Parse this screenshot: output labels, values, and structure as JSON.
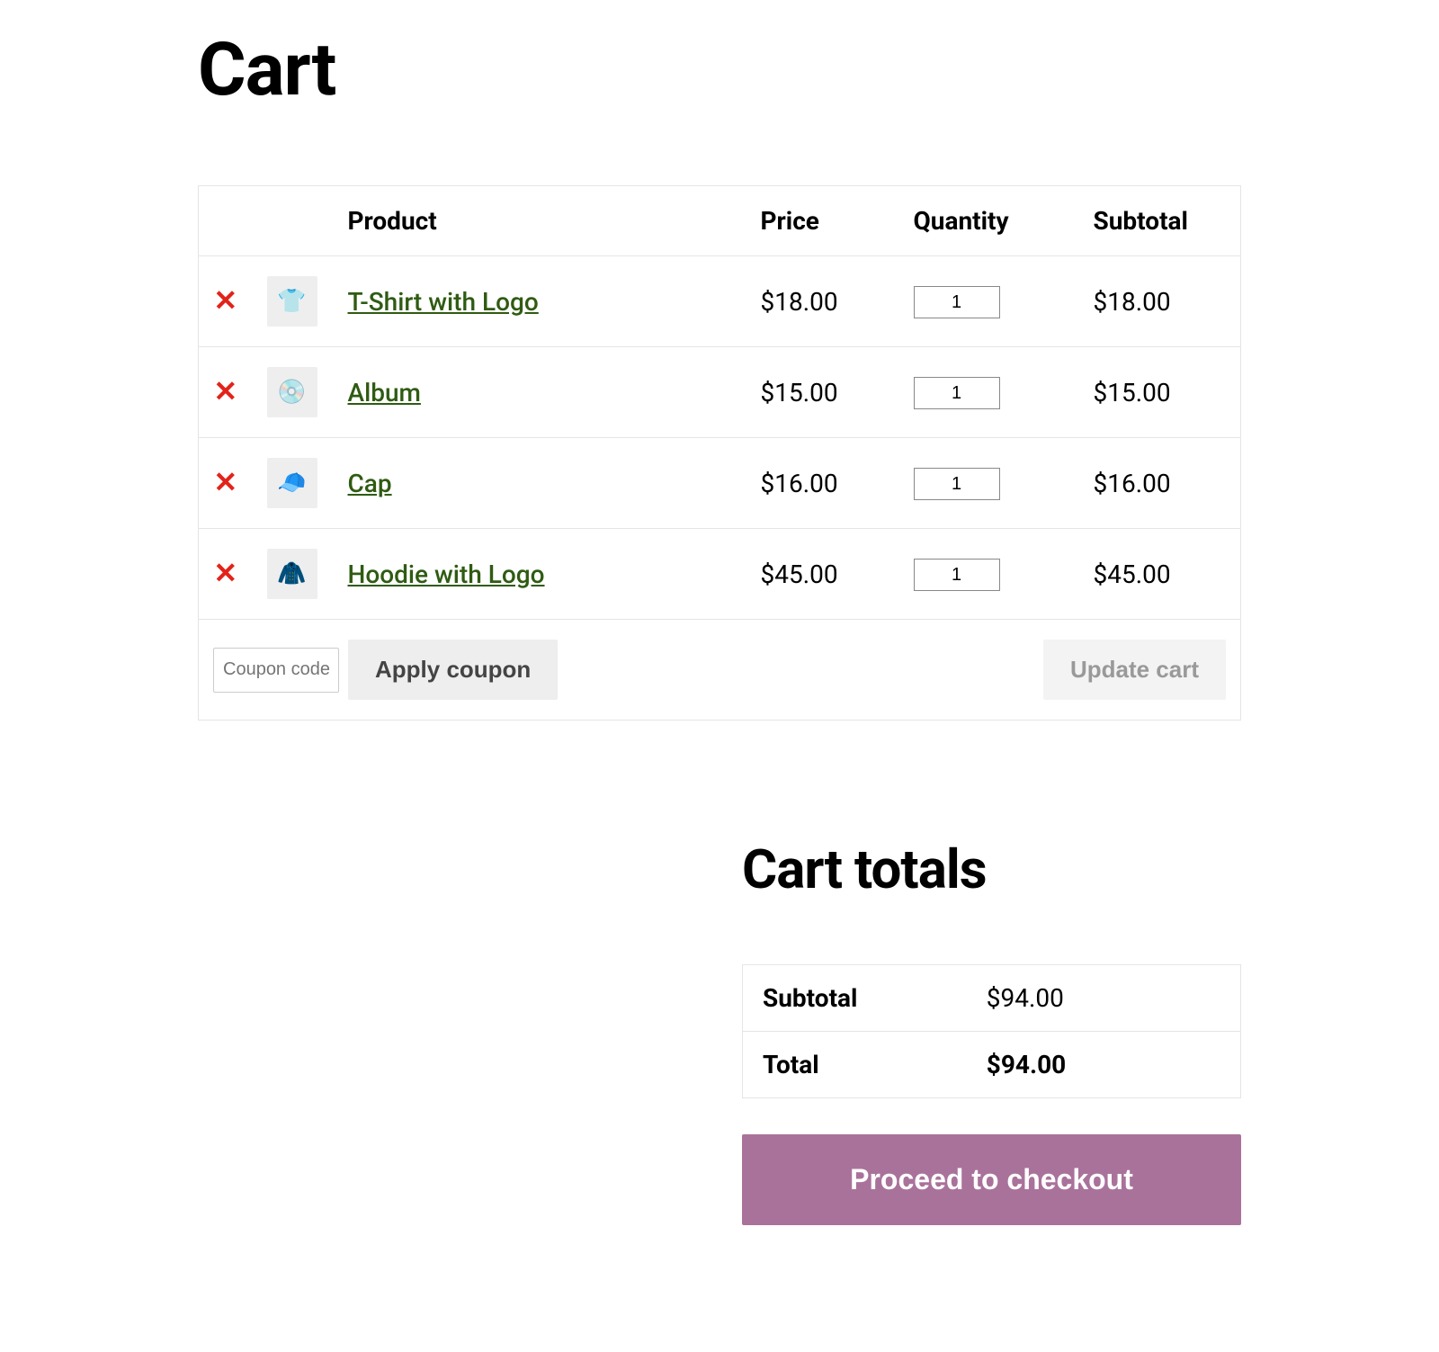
{
  "page": {
    "title": "Cart"
  },
  "table": {
    "headers": {
      "product": "Product",
      "price": "Price",
      "quantity": "Quantity",
      "subtotal": "Subtotal"
    },
    "items": [
      {
        "name": "T-Shirt with Logo",
        "price": "$18.00",
        "qty": "1",
        "subtotal": "$18.00",
        "thumb_glyph": "👕"
      },
      {
        "name": "Album",
        "price": "$15.00",
        "qty": "1",
        "subtotal": "$15.00",
        "thumb_glyph": "💿"
      },
      {
        "name": "Cap",
        "price": "$16.00",
        "qty": "1",
        "subtotal": "$16.00",
        "thumb_glyph": "🧢"
      },
      {
        "name": "Hoodie with Logo",
        "price": "$45.00",
        "qty": "1",
        "subtotal": "$45.00",
        "thumb_glyph": "🧥"
      }
    ],
    "coupon_placeholder": "Coupon code",
    "apply_coupon_label": "Apply coupon",
    "update_cart_label": "Update cart"
  },
  "totals": {
    "title": "Cart totals",
    "subtotal_label": "Subtotal",
    "subtotal_value": "$94.00",
    "total_label": "Total",
    "total_value": "$94.00",
    "checkout_label": "Proceed to checkout"
  }
}
